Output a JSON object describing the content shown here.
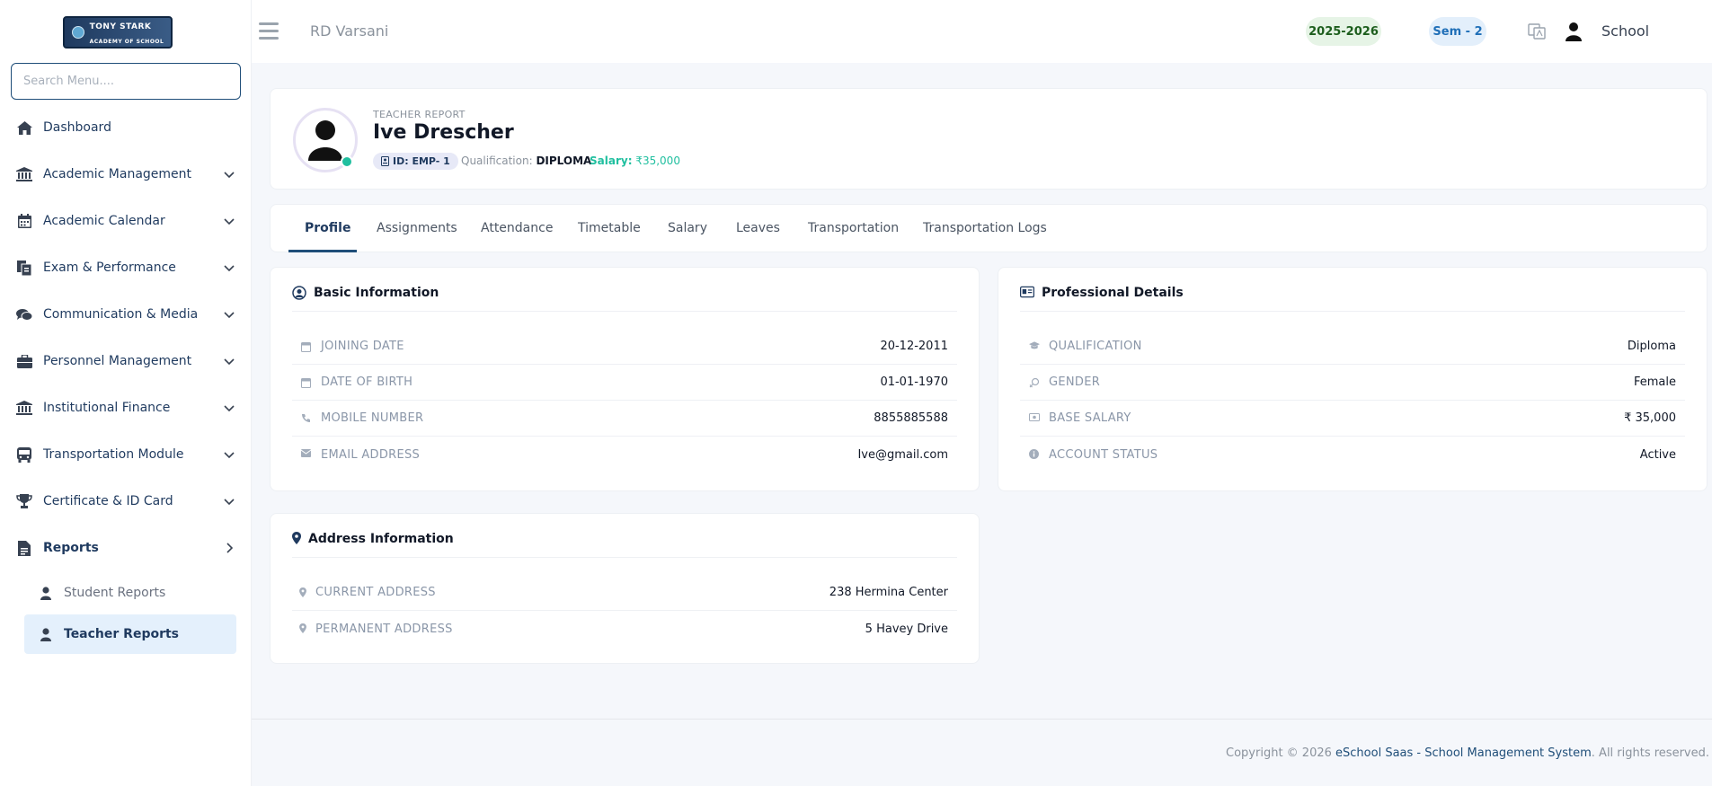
{
  "logo": {
    "text_line1": "TONY STARK",
    "text_line2": "ACADEMY OF SCHOOL"
  },
  "sidebar": {
    "search_placeholder": "Search Menu....",
    "items": [
      {
        "label": "Dashboard",
        "icon": "home-icon"
      },
      {
        "label": "Academic Management",
        "icon": "institution-icon"
      },
      {
        "label": "Academic Calendar",
        "icon": "calendar-icon"
      },
      {
        "label": "Exam & Performance",
        "icon": "exam-icon"
      },
      {
        "label": "Communication & Media",
        "icon": "chat-icon"
      },
      {
        "label": "Personnel Management",
        "icon": "briefcase-icon"
      },
      {
        "label": "Institutional Finance",
        "icon": "bank-icon"
      },
      {
        "label": "Transportation Module",
        "icon": "bus-icon"
      },
      {
        "label": "Certificate & ID Card",
        "icon": "trophy-icon"
      },
      {
        "label": "Reports",
        "icon": "report-icon"
      }
    ],
    "subitems": [
      {
        "label": "Student Reports"
      },
      {
        "label": "Teacher Reports"
      }
    ]
  },
  "header": {
    "school_name": "RD Varsani",
    "session": "2025-2026",
    "semester": "Sem - 2",
    "user_name": "School"
  },
  "profile": {
    "report_label": "TEACHER REPORT",
    "name": "Ive Drescher",
    "id_badge": "ID: EMP- 1",
    "qualification_label": "Qualification:",
    "qualification_value": "DIPLOMA",
    "salary_label": "Salary:",
    "salary_value": "₹35,000"
  },
  "tabs": [
    "Profile",
    "Assignments",
    "Attendance",
    "Timetable",
    "Salary",
    "Leaves",
    "Transportation",
    "Transportation Logs"
  ],
  "basic_info": {
    "title": "Basic Information",
    "rows": [
      {
        "key": "JOINING DATE",
        "value": "20-12-2011"
      },
      {
        "key": "DATE OF BIRTH",
        "value": "01-01-1970"
      },
      {
        "key": "MOBILE NUMBER",
        "value": "8855885588"
      },
      {
        "key": "EMAIL ADDRESS",
        "value": "Ive@gmail.com"
      }
    ]
  },
  "professional": {
    "title": "Professional Details",
    "rows": [
      {
        "key": "QUALIFICATION",
        "value": "Diploma"
      },
      {
        "key": "GENDER",
        "value": "Female"
      },
      {
        "key": "BASE SALARY",
        "value": "₹ 35,000"
      },
      {
        "key": "ACCOUNT STATUS",
        "value": "Active"
      }
    ]
  },
  "address": {
    "title": "Address Information",
    "rows": [
      {
        "key": "CURRENT ADDRESS",
        "value": "238 Hermina Center"
      },
      {
        "key": "PERMANENT ADDRESS",
        "value": "5 Havey Drive"
      }
    ]
  },
  "footer": {
    "prefix": "Copyright © 2026 ",
    "link": "eSchool Saas - School Management System",
    "suffix": ". All rights reserved."
  },
  "colors": {
    "primary": "#1f4e79",
    "accent_green": "#20bf9f",
    "active_bg": "#e4f0fc"
  }
}
